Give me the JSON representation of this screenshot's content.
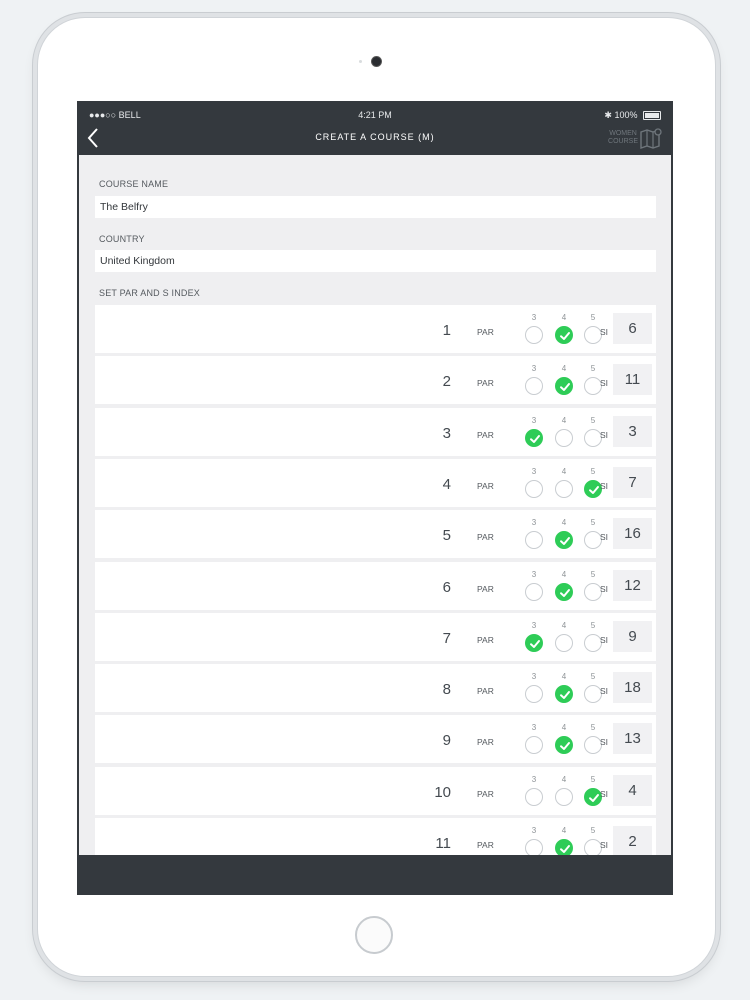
{
  "status": {
    "carrier": "●●●○○ BELL",
    "time": "4:21 PM",
    "battery": "100%"
  },
  "nav": {
    "title": "CREATE A COURSE (M)",
    "toggle_line1": "WOMEN",
    "toggle_line2": "COURSE"
  },
  "form": {
    "course_name_label": "COURSE NAME",
    "course_name_value": "The Belfry",
    "country_label": "COUNTRY",
    "country_value": "United Kingdom",
    "par_section_label": "SET PAR AND S INDEX"
  },
  "row_labels": {
    "par": "PAR",
    "si": "SI",
    "options": [
      "3",
      "4",
      "5"
    ]
  },
  "holes": [
    {
      "number": "1",
      "par": 4,
      "si": "6"
    },
    {
      "number": "2",
      "par": 4,
      "si": "11"
    },
    {
      "number": "3",
      "par": 3,
      "si": "3"
    },
    {
      "number": "4",
      "par": 5,
      "si": "7"
    },
    {
      "number": "5",
      "par": 4,
      "si": "16"
    },
    {
      "number": "6",
      "par": 4,
      "si": "12"
    },
    {
      "number": "7",
      "par": 3,
      "si": "9"
    },
    {
      "number": "8",
      "par": 4,
      "si": "18"
    },
    {
      "number": "9",
      "par": 4,
      "si": "13"
    },
    {
      "number": "10",
      "par": 5,
      "si": "4"
    },
    {
      "number": "11",
      "par": 4,
      "si": "2"
    }
  ],
  "colors": {
    "accent": "#2ecc57",
    "bar": "#34393e"
  }
}
